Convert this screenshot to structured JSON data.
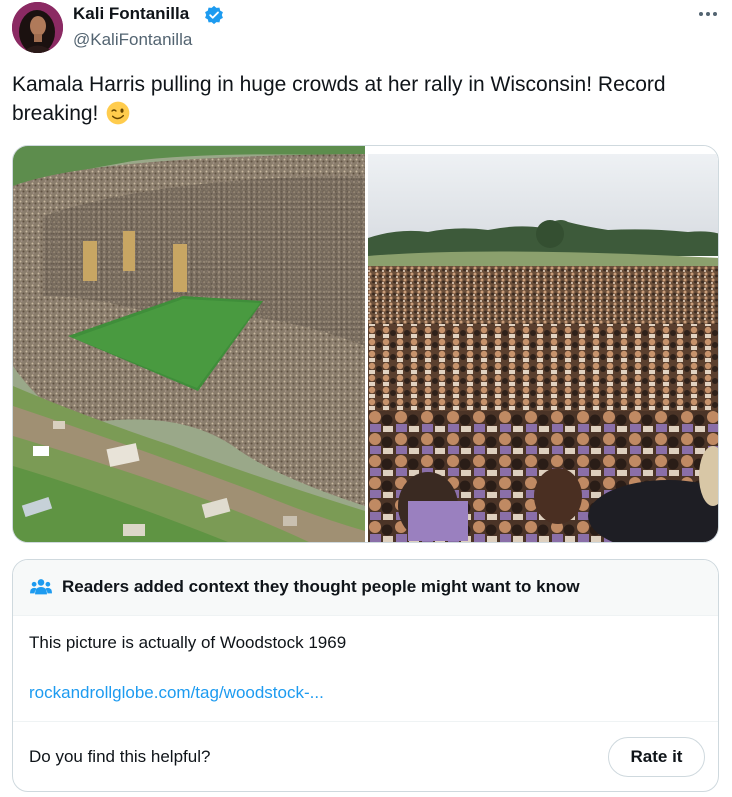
{
  "author": {
    "display_name": "Kali Fontanilla",
    "handle": "@KaliFontanilla",
    "verified": true,
    "verified_color": "#1d9bf0",
    "avatar_icon": "profile-photo"
  },
  "more_icon": "ellipsis-icon",
  "tweet": {
    "text": "Kamala Harris pulling in huge crowds at her rally in Wisconsin! Record breaking! ",
    "emoji": "winking-face"
  },
  "media": {
    "photos": [
      {
        "subject": "aerial-crowd-photo"
      },
      {
        "subject": "ground-level-crowd-photo"
      }
    ]
  },
  "community_note": {
    "header_icon": "people-icon",
    "title": "Readers added context they thought people might want to know",
    "body": "This picture is actually of Woodstock 1969",
    "link_text": "rockandrollglobe.com/tag/woodstock-...",
    "helpful_question": "Do you find this helpful?",
    "rate_button_label": "Rate it",
    "link_color": "#1d9bf0"
  }
}
